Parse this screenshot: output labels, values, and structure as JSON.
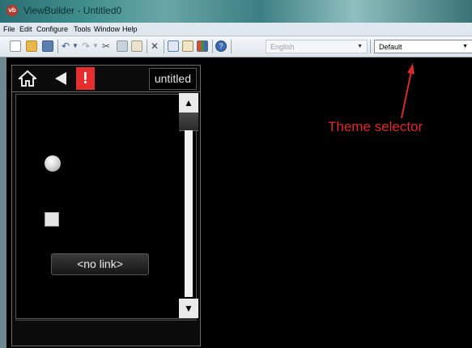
{
  "window": {
    "logo_text": "vb",
    "title": "ViewBuilder - Untitled0"
  },
  "menu": [
    "File",
    "Edit",
    "Configure",
    "Tools",
    "Window",
    "Help"
  ],
  "toolbar": {
    "language": {
      "value": "English"
    },
    "theme": {
      "value": "Default"
    }
  },
  "panel": {
    "page_name": "untitled",
    "alert_symbol": "!",
    "link_button_label": "<no link>",
    "scroll_up_symbol": "▲",
    "scroll_down_symbol": "▼"
  },
  "annotation": {
    "text": "Theme selector",
    "color": "#e02828"
  },
  "colors": {
    "alert": "#e62e2e",
    "canvas": "#000000"
  }
}
